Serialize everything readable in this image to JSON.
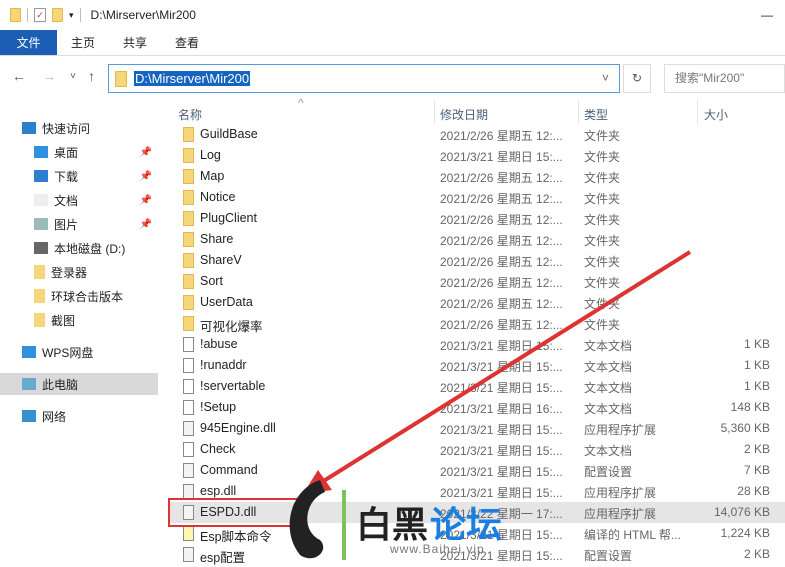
{
  "window": {
    "title": "D:\\Mirserver\\Mir200",
    "minimize": "—"
  },
  "ribbon": {
    "tabs": [
      "文件",
      "主页",
      "共享",
      "查看"
    ]
  },
  "nav": {
    "back": "←",
    "forward": "→",
    "recent": "˅",
    "up": "↑",
    "address": "D:\\Mirserver\\Mir200",
    "dropdown": "˅",
    "refresh": "↻",
    "search_placeholder": "搜索\"Mir200\""
  },
  "sidebar": {
    "items": [
      {
        "label": "快速访问",
        "icon": "star-icon"
      },
      {
        "label": "桌面",
        "icon": "desktop-icon",
        "pinned": true
      },
      {
        "label": "下载",
        "icon": "download-icon",
        "pinned": true
      },
      {
        "label": "文档",
        "icon": "document-icon",
        "pinned": true
      },
      {
        "label": "图片",
        "icon": "pictures-icon",
        "pinned": true
      },
      {
        "label": "本地磁盘 (D:)",
        "icon": "drive-icon"
      },
      {
        "label": "登录器",
        "icon": "folder-icon"
      },
      {
        "label": "环球合击版本",
        "icon": "folder-icon"
      },
      {
        "label": "截图",
        "icon": "folder-icon"
      },
      {
        "label": "WPS网盘",
        "icon": "cloud-icon"
      },
      {
        "label": "此电脑",
        "icon": "computer-icon",
        "selected": true
      },
      {
        "label": "网络",
        "icon": "network-icon"
      }
    ]
  },
  "columns": {
    "name": "名称",
    "date": "修改日期",
    "type": "类型",
    "size": "大小",
    "sort": "^"
  },
  "files": [
    {
      "name": "GuildBase",
      "date": "2021/2/26 星期五 12:...",
      "type": "文件夹",
      "size": "",
      "kind": "folder"
    },
    {
      "name": "Log",
      "date": "2021/3/21 星期日 15:...",
      "type": "文件夹",
      "size": "",
      "kind": "folder"
    },
    {
      "name": "Map",
      "date": "2021/2/26 星期五 12:...",
      "type": "文件夹",
      "size": "",
      "kind": "folder"
    },
    {
      "name": "Notice",
      "date": "2021/2/26 星期五 12:...",
      "type": "文件夹",
      "size": "",
      "kind": "folder"
    },
    {
      "name": "PlugClient",
      "date": "2021/2/26 星期五 12:...",
      "type": "文件夹",
      "size": "",
      "kind": "folder"
    },
    {
      "name": "Share",
      "date": "2021/2/26 星期五 12:...",
      "type": "文件夹",
      "size": "",
      "kind": "folder"
    },
    {
      "name": "ShareV",
      "date": "2021/2/26 星期五 12:...",
      "type": "文件夹",
      "size": "",
      "kind": "folder"
    },
    {
      "name": "Sort",
      "date": "2021/2/26 星期五 12:...",
      "type": "文件夹",
      "size": "",
      "kind": "folder"
    },
    {
      "name": "UserData",
      "date": "2021/2/26 星期五 12:...",
      "type": "文件夹",
      "size": "",
      "kind": "folder"
    },
    {
      "name": "可视化爆率",
      "date": "2021/2/26 星期五 12:...",
      "type": "文件夹",
      "size": "",
      "kind": "folder"
    },
    {
      "name": "!abuse",
      "date": "2021/3/21 星期日 15:...",
      "type": "文本文档",
      "size": "1 KB",
      "kind": "doc"
    },
    {
      "name": "!runaddr",
      "date": "2021/3/21 星期日 15:...",
      "type": "文本文档",
      "size": "1 KB",
      "kind": "doc"
    },
    {
      "name": "!servertable",
      "date": "2021/3/21 星期日 15:...",
      "type": "文本文档",
      "size": "1 KB",
      "kind": "doc"
    },
    {
      "name": "!Setup",
      "date": "2021/3/21 星期日 16:...",
      "type": "文本文档",
      "size": "148 KB",
      "kind": "doc"
    },
    {
      "name": "945Engine.dll",
      "date": "2021/3/21 星期日 15:...",
      "type": "应用程序扩展",
      "size": "5,360 KB",
      "kind": "dll"
    },
    {
      "name": "Check",
      "date": "2021/3/21 星期日 15:...",
      "type": "文本文档",
      "size": "2 KB",
      "kind": "doc"
    },
    {
      "name": "Command",
      "date": "2021/3/21 星期日 15:...",
      "type": "配置设置",
      "size": "7 KB",
      "kind": "dll"
    },
    {
      "name": "esp.dll",
      "date": "2021/3/21 星期日 15:...",
      "type": "应用程序扩展",
      "size": "28 KB",
      "kind": "dll"
    },
    {
      "name": "ESPDJ.dll",
      "date": "2021/3/22 星期一 17:...",
      "type": "应用程序扩展",
      "size": "14,076 KB",
      "kind": "dll",
      "highlighted": true
    },
    {
      "name": "Esp脚本命令",
      "date": "2021/3/21 星期日 15:...",
      "type": "编译的 HTML 帮...",
      "size": "1,224 KB",
      "kind": "help"
    },
    {
      "name": "esp配置",
      "date": "2021/3/21 星期日 15:...",
      "type": "配置设置",
      "size": "2 KB",
      "kind": "dll"
    }
  ],
  "watermark": {
    "text1": "白黑",
    "text2": "论坛",
    "url": "www.Baihei.vip"
  },
  "colors": {
    "accent": "#1a5fb4",
    "selection": "#1565c0",
    "annotation": "#dd3333"
  }
}
